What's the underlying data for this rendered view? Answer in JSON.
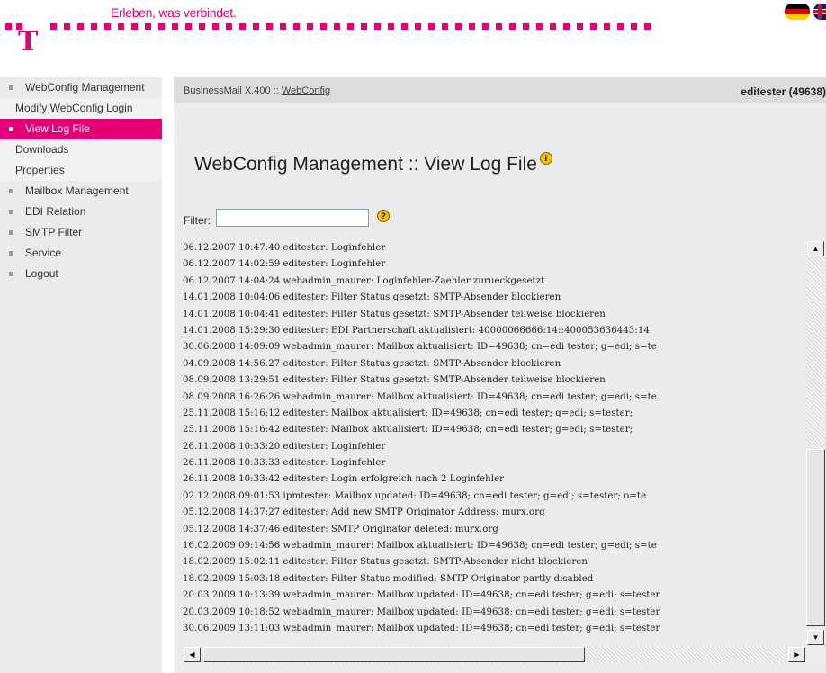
{
  "header": {
    "slogan": "Erleben, was verbindet.",
    "logo_letter": "T",
    "brand_color": "#e20074",
    "flags": [
      "flag-de-icon",
      "flag-uk-icon"
    ]
  },
  "sidebar": {
    "items": [
      {
        "label": "WebConfig Management",
        "type": "main",
        "active": false
      },
      {
        "label": "Modify WebConfig Login",
        "type": "sub",
        "active": false
      },
      {
        "label": "View Log File",
        "type": "sub",
        "active": true
      },
      {
        "label": "Downloads",
        "type": "sub",
        "active": false
      },
      {
        "label": "Properties",
        "type": "sub",
        "active": false
      },
      {
        "label": "Mailbox Management",
        "type": "main",
        "active": false
      },
      {
        "label": "EDI Relation",
        "type": "main",
        "active": false
      },
      {
        "label": "SMTP Filter",
        "type": "main",
        "active": false
      },
      {
        "label": "Service",
        "type": "main",
        "active": false
      },
      {
        "label": "Logout",
        "type": "main",
        "active": false
      }
    ]
  },
  "breadcrumb": {
    "prefix": "BusinessMail X.400 :: ",
    "link": "WebConfig"
  },
  "user": "editester (49638)",
  "page": {
    "title": "WebConfig Management :: View Log File",
    "info_icon": "info-icon"
  },
  "filter": {
    "label": "Filter:",
    "value": "",
    "help_icon": "help-icon"
  },
  "log": {
    "lines": [
      "06.12.2007 10:47:40 editester: Loginfehler",
      "06.12.2007 14:02:59 editester: Loginfehler",
      "06.12.2007 14:04:24 webadmin_maurer: Loginfehler-Zaehler zurueckgesetzt",
      "14.01.2008 10:04:06 editester: Filter Status gesetzt: SMTP-Absender blockieren",
      "14.01.2008 10:04:41 editester: Filter Status gesetzt: SMTP-Absender teilweise blockieren",
      "14.01.2008 15:29:30 editester: EDI Partnerschaft aktualisiert: 40000066666:14::400053636443:14",
      "30.06.2008 14:09:09 webadmin_maurer: Mailbox aktualisiert: ID=49638; cn=edi tester; g=edi; s=te",
      "04.09.2008 14:56:27 editester: Filter Status gesetzt: SMTP-Absender blockieren",
      "08.09.2008 13:29:51 editester: Filter Status gesetzt: SMTP-Absender teilweise blockieren",
      "08.09.2008 16:26:26 webadmin_maurer: Mailbox aktualisiert: ID=49638; cn=edi tester; g=edi; s=te",
      "25.11.2008 15:16:12 editester: Mailbox aktualisiert: ID=49638; cn=edi tester; g=edi; s=tester;",
      "25.11.2008 15:16:42 editester: Mailbox aktualisiert: ID=49638; cn=edi tester; g=edi; s=tester;",
      "26.11.2008 10:33:20 editester: Loginfehler",
      "26.11.2008 10:33:33 editester: Loginfehler",
      "26.11.2008 10:33:42 editester: Login erfolgreich nach 2 Loginfehler",
      "02.12.2008 09:01:53 ipmtester: Mailbox updated: ID=49638; cn=edi tester; g=edi; s=tester; o=te",
      "05.12.2008 14:37:27 editester: Add new SMTP Originator Address: murx.org",
      "05.12.2008 14:37:46 editester: SMTP Originator deleted: murx.org",
      "16.02.2009 09:14:56 webadmin_maurer: Mailbox aktualisiert: ID=49638; cn=edi tester; g=edi; s=te",
      "18.02.2009 15:02:11 editester: Filter Status gesetzt: SMTP-Absender nicht blockieren",
      "18.02.2009 15:03:18 editester: Filter Status modified: SMTP Originator partly disabled",
      "20.03.2009 10:13:39 webadmin_maurer: Mailbox updated: ID=49638; cn=edi tester; g=edi; s=tester",
      "20.03.2009 10:18:52 webadmin_maurer: Mailbox updated: ID=49638; cn=edi tester; g=edi; s=tester",
      "30.06.2009 13:11:03 webadmin_maurer: Mailbox updated: ID=49638; cn=edi tester; g=edi; s=tester"
    ]
  }
}
